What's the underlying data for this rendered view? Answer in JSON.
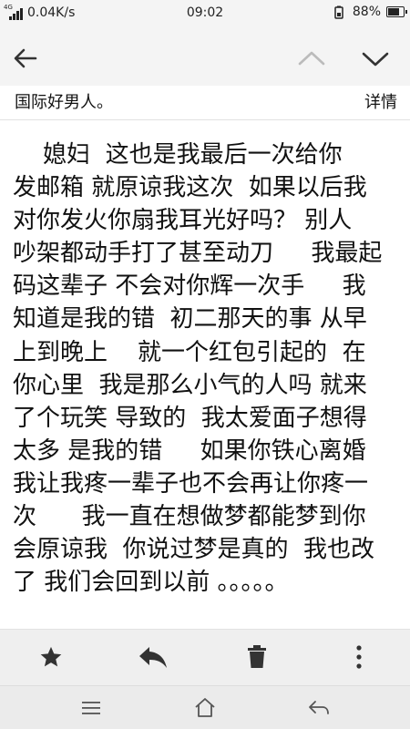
{
  "status_bar": {
    "network_tag": "4G",
    "speed": "0.04K/s",
    "time": "09:02",
    "battery": "88%",
    "battery_level": 0.88,
    "icons": [
      "signal-icon",
      "battery-saver-icon",
      "battery-icon"
    ]
  },
  "top_nav": {
    "icons": [
      "back-arrow-icon",
      "chevron-up-icon",
      "chevron-down-icon"
    ]
  },
  "subject": {
    "text": "国际好男人。",
    "details_label": "详情"
  },
  "body_lines": [
    "    媳妇  这也是我最后一次给你",
    "发邮箱 就原谅我这次  如果以后我",
    "对你发火你扇我耳光好吗？ 别人",
    "吵架都动手打了甚至动刀     我最起",
    "码这辈子 不会对你辉一次手     我",
    "知道是我的错  初二那天的事 从早",
    "上到晚上    就一个红包引起的  在",
    "你心里  我是那么小气的人吗 就来",
    "了个玩笑 导致的  我太爱面子想得",
    "太多 是我的错     如果你铁心离婚",
    "我让我疼一辈子也不会再让你疼一",
    "次      我一直在想做梦都能梦到你",
    "会原谅我  你说过梦是真的  我也改",
    "了 我们会回到以前 。。。。。"
  ],
  "toolbar": {
    "icons": [
      "star-icon",
      "reply-icon",
      "trash-icon",
      "more-vertical-icon"
    ]
  },
  "system_nav": {
    "icons": [
      "menu-icon",
      "home-icon",
      "back-icon"
    ]
  },
  "colors": {
    "bar_background": "#f4f4f4",
    "toolbar_background": "#efefef",
    "icon_dark": "#333333",
    "icon_light": "#bbbbbb"
  }
}
